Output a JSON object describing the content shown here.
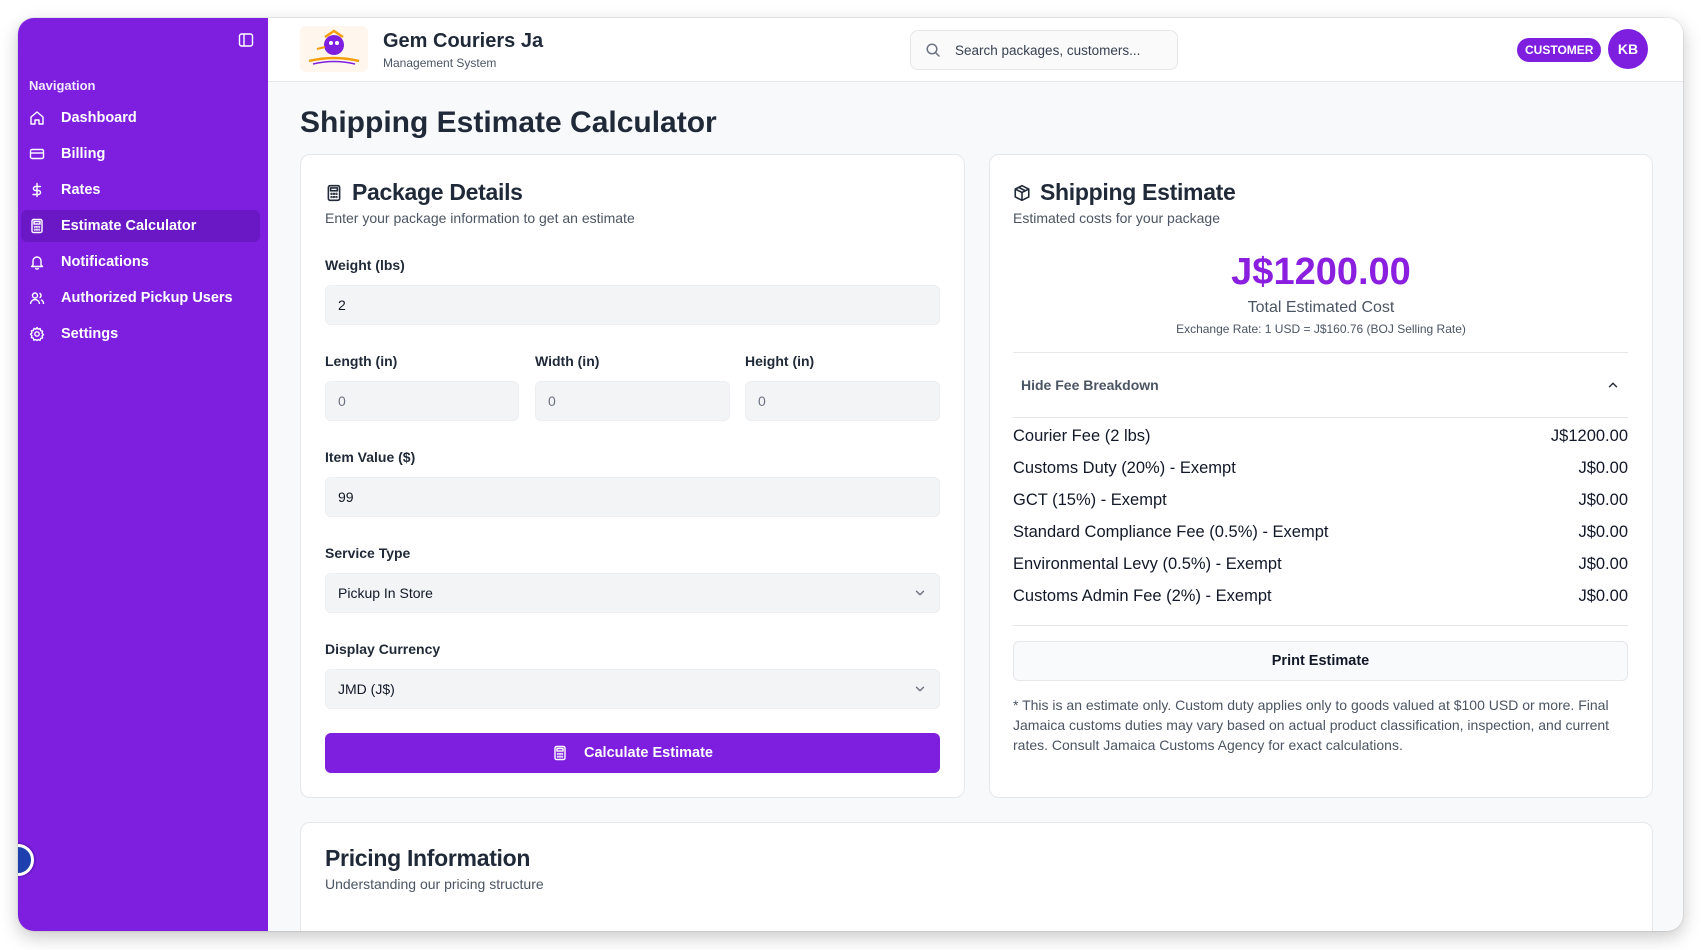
{
  "sidebar": {
    "heading": "Navigation",
    "items": [
      {
        "label": "Dashboard",
        "icon": "home-icon"
      },
      {
        "label": "Billing",
        "icon": "credit-card-icon"
      },
      {
        "label": "Rates",
        "icon": "dollar-icon"
      },
      {
        "label": "Estimate Calculator",
        "icon": "calculator-icon",
        "active": true
      },
      {
        "label": "Notifications",
        "icon": "bell-icon"
      },
      {
        "label": "Authorized Pickup Users",
        "icon": "users-icon"
      },
      {
        "label": "Settings",
        "icon": "gear-icon"
      }
    ]
  },
  "header": {
    "brand_title": "Gem Couriers Ja",
    "brand_subtitle": "Management System",
    "search_placeholder": "Search packages, customers...",
    "role_badge": "CUSTOMER",
    "avatar_initials": "KB"
  },
  "page": {
    "title": "Shipping Estimate Calculator"
  },
  "package_details": {
    "title": "Package Details",
    "subtitle": "Enter your package information to get an estimate",
    "weight_label": "Weight (lbs)",
    "weight_value": "2",
    "length_label": "Length (in)",
    "length_value": "0",
    "width_label": "Width (in)",
    "width_value": "0",
    "height_label": "Height (in)",
    "height_value": "0",
    "item_value_label": "Item Value ($)",
    "item_value_value": "99",
    "service_type_label": "Service Type",
    "service_type_value": "Pickup In Store",
    "currency_label": "Display Currency",
    "currency_value": "JMD (J$)",
    "calculate_label": "Calculate Estimate"
  },
  "estimate": {
    "title": "Shipping Estimate",
    "subtitle": "Estimated costs for your package",
    "total": "J$1200.00",
    "total_label": "Total Estimated Cost",
    "exchange_rate": "Exchange Rate: 1 USD = J$160.76 (BOJ Selling Rate)",
    "breakdown_toggle": "Hide Fee Breakdown",
    "fees": [
      {
        "label": "Courier Fee (2 lbs)",
        "amount": "J$1200.00"
      },
      {
        "label": "Customs Duty (20%) - Exempt",
        "amount": "J$0.00"
      },
      {
        "label": "GCT (15%) - Exempt",
        "amount": "J$0.00"
      },
      {
        "label": "Standard Compliance Fee (0.5%) - Exempt",
        "amount": "J$0.00"
      },
      {
        "label": "Environmental Levy (0.5%) - Exempt",
        "amount": "J$0.00"
      },
      {
        "label": "Customs Admin Fee (2%) - Exempt",
        "amount": "J$0.00"
      }
    ],
    "print_label": "Print Estimate",
    "disclaimer": "* This is an estimate only. Custom duty applies only to goods valued at $100 USD or more. Final Jamaica customs duties may vary based on actual product classification, inspection, and current rates. Consult Jamaica Customs Agency for exact calculations."
  },
  "pricing_info": {
    "title": "Pricing Information",
    "subtitle": "Understanding our pricing structure"
  },
  "colors": {
    "brand_purple": "#7e1fe0",
    "sidebar_active": "#6a18c6",
    "total_text": "#8b1fe0"
  }
}
